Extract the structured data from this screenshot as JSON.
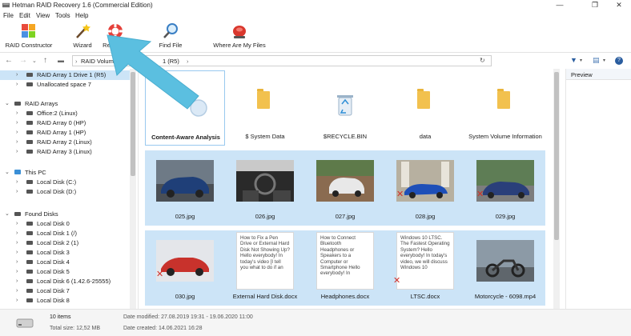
{
  "window": {
    "title": "Hetman RAID Recovery 1.6 (Commercial Edition)",
    "minimize": "—",
    "maximize": "❐",
    "close": "✕"
  },
  "menu": [
    "File",
    "Edit",
    "View",
    "Tools",
    "Help"
  ],
  "toolbar": {
    "raid_constructor": "RAID Constructor",
    "wizard": "Wizard",
    "recovery": "Recovery",
    "find_file": "Find File",
    "where_are_my_files": "Where Are My Files"
  },
  "address": {
    "root": "RAID Volumes",
    "separator": "›",
    "partial": "1 (R5)",
    "end_sep": "›"
  },
  "tree": {
    "raid_drive": "RAID Array 1 Drive 1 (R5)",
    "unallocated": "Unallocated space 7",
    "raid_arrays": "RAID Arrays",
    "arrays": [
      "Office:2 (Linux)",
      "RAID Array 0 (HP)",
      "RAID Array 1 (HP)",
      "RAID Array 2 (Linux)",
      "RAID Array 3 (Linux)"
    ],
    "this_pc": "This PC",
    "pc_disks": [
      "Local Disk (C:)",
      "Local Disk (D:)"
    ],
    "found_disks": "Found Disks",
    "found": [
      "Local Disk 0",
      "Local Disk 1 (/)",
      "Local Disk 2 (1)",
      "Local Disk 3",
      "Local Disk 4",
      "Local Disk 5",
      "Local Disk 6 (1.42.6-25555)",
      "Local Disk 7",
      "Local Disk 8"
    ]
  },
  "items": {
    "row1": [
      "Content-Aware Analysis",
      "$ System Data",
      "$RECYCLE.BIN",
      "data",
      "System Volume Information"
    ],
    "row2": [
      "025.jpg",
      "026.jpg",
      "027.jpg",
      "028.jpg",
      "029.jpg"
    ],
    "row3": [
      "030.jpg",
      "External Hard Disk.docx",
      "Headphones.docx",
      "LTSC.docx",
      "Motorcycle - 6098.mp4"
    ]
  },
  "docs": {
    "external": "How to Fix a Pen Drive or External Hard Disk Not Showing Up? Hello everybody! In today's video [I tell you what to do if an",
    "headphones": "How to Connect Bluetooth Headphones or Speakers to a Computer or Smartphone Hello everybody! In",
    "ltsc": "Windows 10 LTSC. The Fastest Operating System? Hello everybody! In today's video, we will discuss Windows 10"
  },
  "preview": {
    "title": "Preview"
  },
  "status": {
    "count": "10 items",
    "total_size": "Total size: 12,52 MB",
    "modified": "Date modified: 27.08.2019 19:31 - 19.06.2020 11:00",
    "created": "Date created: 14.06.2021 16:28"
  },
  "colors": {
    "selection": "#cce4f7",
    "pointer_arrow": "#5bbfe0",
    "folder": "#f2c14e",
    "delete_mark": "#d0302a"
  }
}
